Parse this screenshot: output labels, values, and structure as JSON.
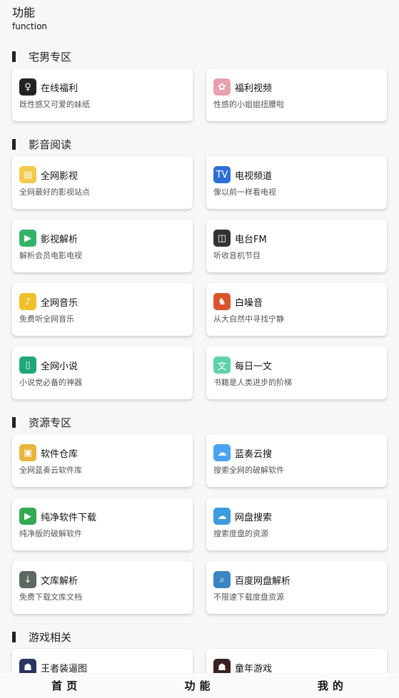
{
  "header": {
    "title": "功能",
    "subtitle": "function"
  },
  "sections": [
    {
      "title": "宅男专区",
      "items": [
        {
          "title": "在线福利",
          "desc": "既性感又可爱的妹纸",
          "icon": "silhouette-icon",
          "color": "#222222"
        },
        {
          "title": "福利视频",
          "desc": "性感的小姐姐扭腰啦",
          "icon": "dancer-icon",
          "color": "#e8a0b0"
        }
      ]
    },
    {
      "title": "影音阅读",
      "items": [
        {
          "title": "全网影视",
          "desc": "全网最好的影视站点",
          "icon": "clapperboard-icon",
          "color": "#f5c94a"
        },
        {
          "title": "电视频道",
          "desc": "像以前一样看电视",
          "icon": "tv-icon",
          "color": "#2f6fd6"
        },
        {
          "title": "影视解析",
          "desc": "解析会员电影电视",
          "icon": "play-icon",
          "color": "#33b36a"
        },
        {
          "title": "电台FM",
          "desc": "听收音机节目",
          "icon": "radio-icon",
          "color": "#333333"
        },
        {
          "title": "全网音乐",
          "desc": "免费听全网音乐",
          "icon": "music-icon",
          "color": "#f0c02a"
        },
        {
          "title": "白噪音",
          "desc": "从大自然中寻找宁静",
          "icon": "deer-icon",
          "color": "#d9542c"
        },
        {
          "title": "全网小说",
          "desc": "小说党必备的神器",
          "icon": "book-icon",
          "color": "#1fa67a"
        },
        {
          "title": "每日一文",
          "desc": "书籍是人类进步的阶梯",
          "icon": "article-icon",
          "color": "#5fd3a8"
        }
      ]
    },
    {
      "title": "资源专区",
      "items": [
        {
          "title": "软件仓库",
          "desc": "全网蓝奏云软件库",
          "icon": "gift-icon",
          "color": "#e9b53a"
        },
        {
          "title": "蓝奏云搜",
          "desc": "搜索全网的破解软件",
          "icon": "cloud-icon",
          "color": "#4aa3f0"
        },
        {
          "title": "纯净软件下载",
          "desc": "纯净版的破解软件",
          "icon": "google-play-icon",
          "color": "#34a853"
        },
        {
          "title": "网盘搜索",
          "desc": "搜索度盘的资源",
          "icon": "cloud-search-icon",
          "color": "#3d9be0"
        },
        {
          "title": "文库解析",
          "desc": "免费下载文库文档",
          "icon": "download-icon",
          "color": "#5a6a60"
        },
        {
          "title": "百度网盘解析",
          "desc": "不限速下载度盘资源",
          "icon": "magnifier-icon",
          "color": "#3b84c4"
        }
      ]
    },
    {
      "title": "游戏相关",
      "items": [
        {
          "title": "王者装逼图",
          "desc": "",
          "icon": "game-avatar-icon",
          "color": "#2a3560"
        },
        {
          "title": "童年游戏",
          "desc": "",
          "icon": "retro-game-icon",
          "color": "#3a2020"
        }
      ]
    }
  ],
  "tabbar": [
    {
      "label": "首页"
    },
    {
      "label": "功能"
    },
    {
      "label": "我的"
    }
  ]
}
